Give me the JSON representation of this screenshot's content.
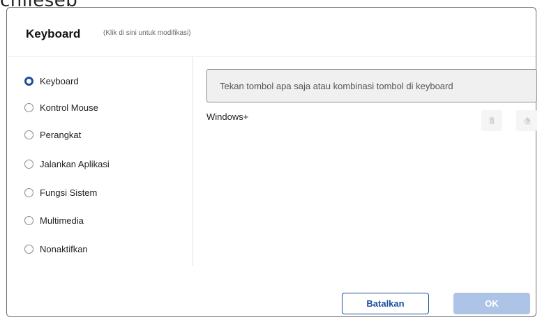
{
  "background": {
    "partial_title": "cnileseb"
  },
  "dialog": {
    "title": "Keyboard",
    "hint": "(Klik di sini untuk modifikasi)"
  },
  "sidebar": {
    "selected": "Keyboard",
    "items": [
      {
        "label": "Keyboard",
        "checked": true
      },
      {
        "label": "Kontrol Mouse",
        "checked": false
      },
      {
        "label": "Perangkat",
        "checked": false
      },
      {
        "label": "Jalankan Aplikasi",
        "checked": false
      },
      {
        "label": "Fungsi Sistem",
        "checked": false
      },
      {
        "label": "Multimedia",
        "checked": false
      },
      {
        "label": "Nonaktifkan",
        "checked": false
      }
    ]
  },
  "main": {
    "key_input_placeholder": "Tekan tombol apa saja atau kombinasi tombol di keyboard",
    "combo": "Windows+",
    "icons": {
      "delete": "trash-icon",
      "clear": "eraser-icon"
    }
  },
  "footer": {
    "cancel_label": "Batalkan",
    "ok_label": "OK"
  },
  "colors": {
    "accent": "#1a4fa0",
    "ok_disabled": "#aec4e6"
  }
}
